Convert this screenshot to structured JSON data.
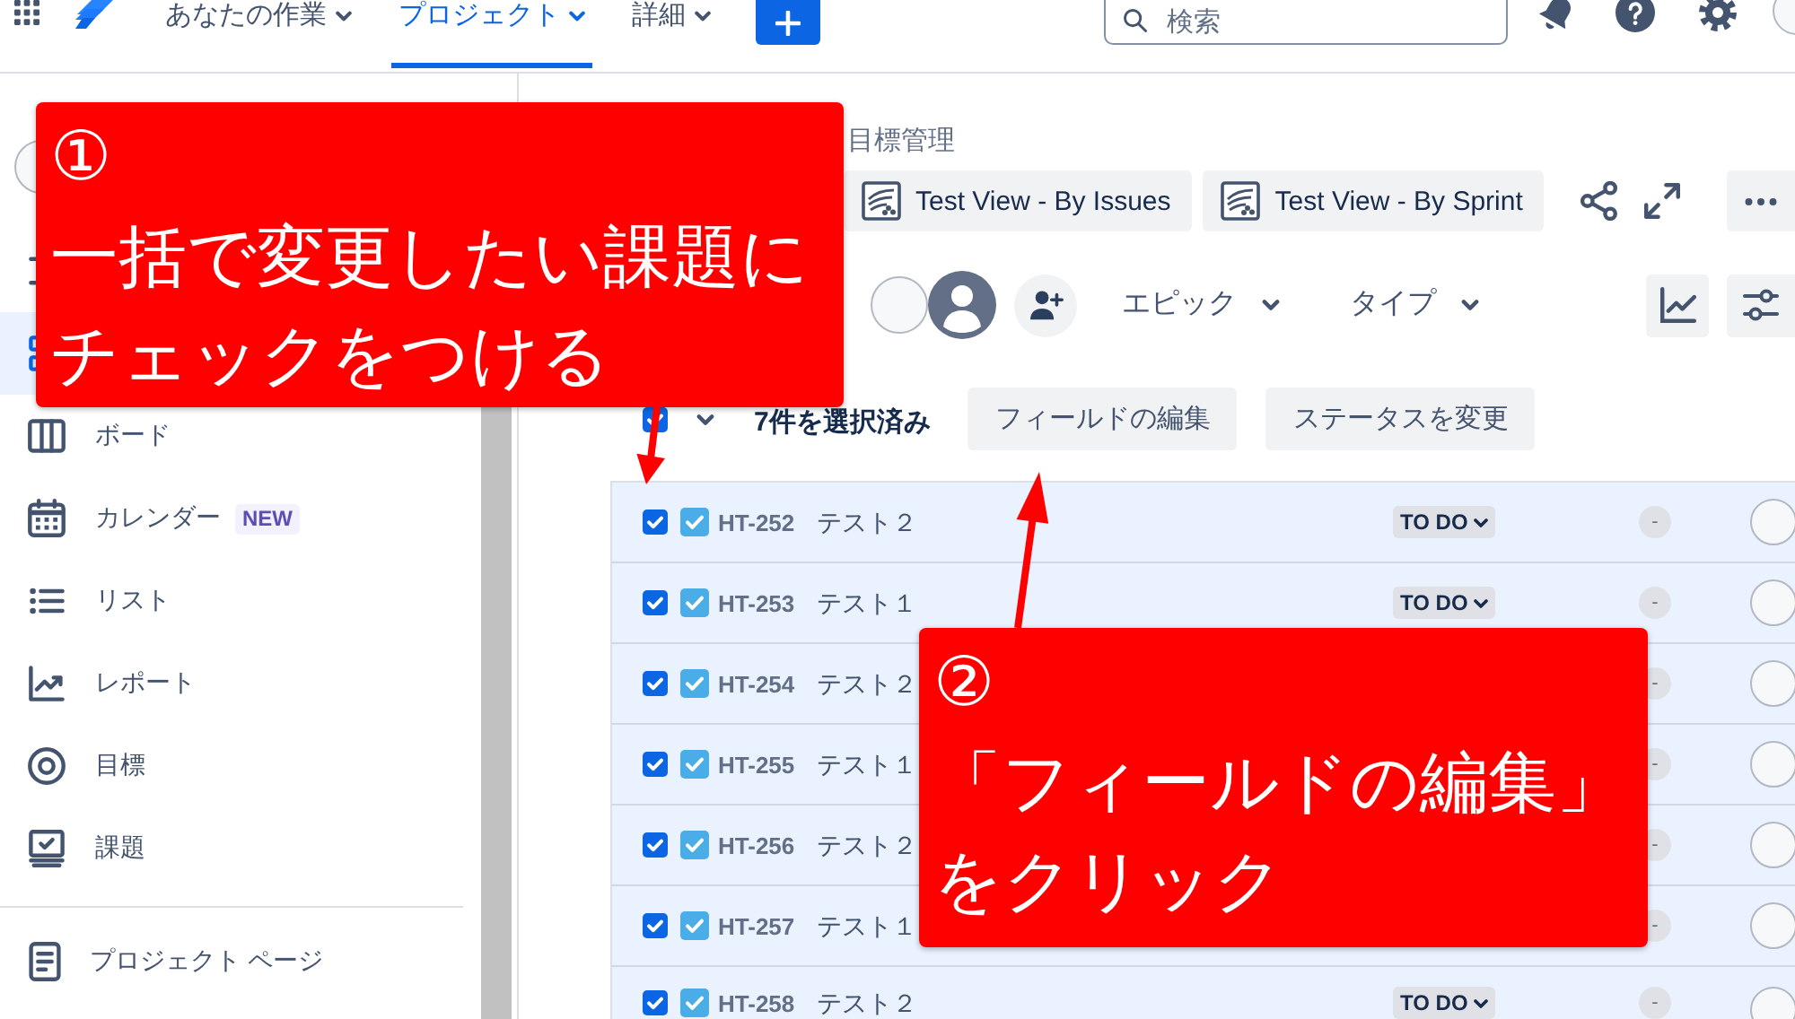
{
  "top_nav": {
    "tabs": [
      {
        "label": "あなたの作業",
        "selected": false
      },
      {
        "label": "プロジェクト",
        "selected": true
      },
      {
        "label": "詳細",
        "selected": false
      }
    ],
    "search": {
      "placeholder": "検索"
    }
  },
  "sidebar": {
    "items": [
      {
        "selected": false
      },
      {
        "selected": true
      },
      {
        "label": "ボード",
        "selected": false
      },
      {
        "label": "カレンダー",
        "badge": "NEW",
        "selected": false
      },
      {
        "label": "リスト",
        "selected": false
      },
      {
        "label": "レポート",
        "selected": false
      },
      {
        "label": "目標",
        "selected": false
      },
      {
        "label": "課題",
        "selected": false
      }
    ],
    "footer_items": [
      {
        "label": "プロジェクト ページ"
      }
    ]
  },
  "header": {
    "breadcrumb": "目標管理",
    "views": [
      {
        "label": "Test View - By Issues"
      },
      {
        "label": "Test View - By Sprint"
      }
    ],
    "filters": [
      {
        "label": "エピック"
      },
      {
        "label": "タイプ"
      }
    ]
  },
  "bulk_bar": {
    "checked": true,
    "count_label": "7件を選択済み",
    "actions": [
      {
        "label": "フィールドの編集"
      },
      {
        "label": "ステータスを変更"
      }
    ]
  },
  "issues": [
    {
      "checked": true,
      "key": "HT-252",
      "summary": "テスト２",
      "status": "TO DO",
      "column_5": "-"
    },
    {
      "checked": true,
      "key": "HT-253",
      "summary": "テスト１",
      "status": "TO DO",
      "column_5": "-"
    },
    {
      "checked": true,
      "key": "HT-254",
      "summary": "テスト２",
      "column_5": "-"
    },
    {
      "checked": true,
      "key": "HT-255",
      "summary": "テスト１",
      "column_5": "-"
    },
    {
      "checked": true,
      "key": "HT-256",
      "summary": "テスト２",
      "column_5": "-"
    },
    {
      "checked": true,
      "key": "HT-257",
      "summary": "テスト１",
      "column_5": "-"
    },
    {
      "checked": true,
      "key": "HT-258",
      "summary": "テスト２",
      "status": "TO DO",
      "column_5": "-"
    }
  ],
  "callouts": [
    {
      "number": "①",
      "text": "一括で変更したい課題にチェックをつける"
    },
    {
      "number": "②",
      "text": "「フィールドの編集」をクリック"
    }
  ]
}
